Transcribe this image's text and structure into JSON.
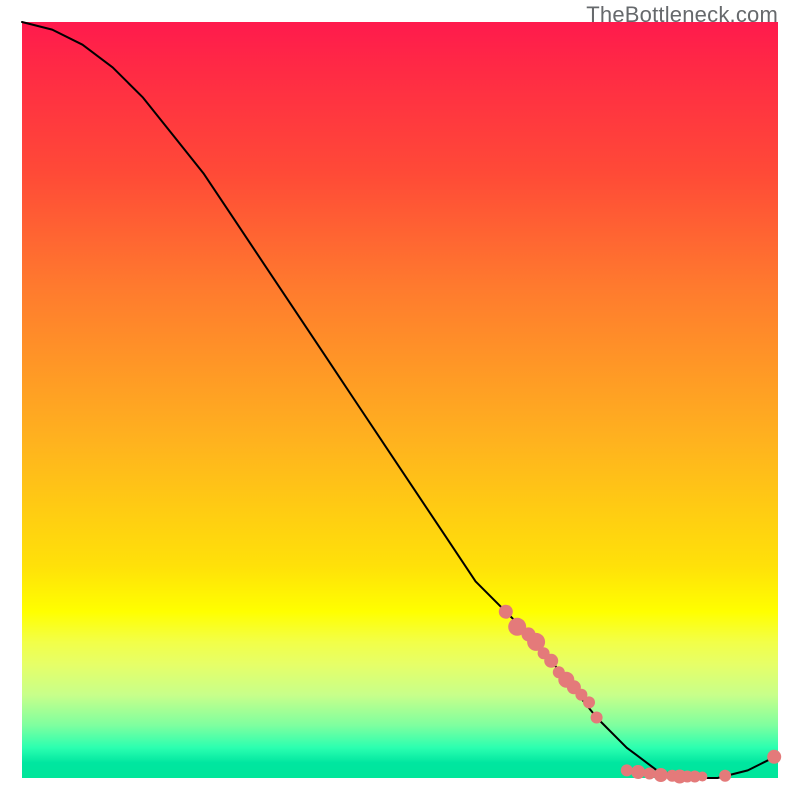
{
  "watermark": "TheBottleneck.com",
  "colors": {
    "curve": "#000000",
    "marker": "#e47a7a",
    "watermark": "#66696c"
  },
  "chart_data": {
    "type": "line",
    "title": "",
    "xlabel": "",
    "ylabel": "",
    "xlim": [
      0,
      100
    ],
    "ylim": [
      0,
      100
    ],
    "grid": false,
    "legend": false,
    "annotations": [
      "TheBottleneck.com"
    ],
    "series": [
      {
        "name": "bottleneck-curve",
        "x": [
          0,
          4,
          8,
          12,
          16,
          20,
          24,
          28,
          32,
          36,
          40,
          44,
          48,
          52,
          56,
          60,
          64,
          68,
          72,
          76,
          80,
          84,
          88,
          92,
          96,
          100
        ],
        "y": [
          100,
          99,
          97,
          94,
          90,
          85,
          80,
          74,
          68,
          62,
          56,
          50,
          44,
          38,
          32,
          26,
          22,
          18,
          13,
          8,
          4,
          1,
          0,
          0,
          1,
          3
        ]
      }
    ],
    "markers": [
      {
        "name": "highlight-points",
        "x": [
          64.0,
          65.5,
          67.0,
          68.0,
          69.0,
          70.0,
          71.0,
          72.0,
          73.0,
          74.0,
          75.0,
          76.0,
          80.0,
          81.5,
          83.0,
          84.5,
          86.0,
          87.0,
          88.0,
          89.0,
          90.0,
          93.0,
          99.5
        ],
        "y": [
          22.0,
          20.0,
          19.0,
          18.0,
          16.5,
          15.5,
          14.0,
          13.0,
          12.0,
          11.0,
          10.0,
          8.0,
          1.0,
          0.8,
          0.6,
          0.4,
          0.3,
          0.2,
          0.2,
          0.2,
          0.2,
          0.3,
          2.8
        ],
        "r": [
          7,
          9,
          7,
          9,
          6,
          7,
          6,
          8,
          7,
          6,
          6,
          6,
          6,
          7,
          6,
          7,
          6,
          7,
          6,
          6,
          5,
          6,
          7
        ]
      }
    ]
  }
}
